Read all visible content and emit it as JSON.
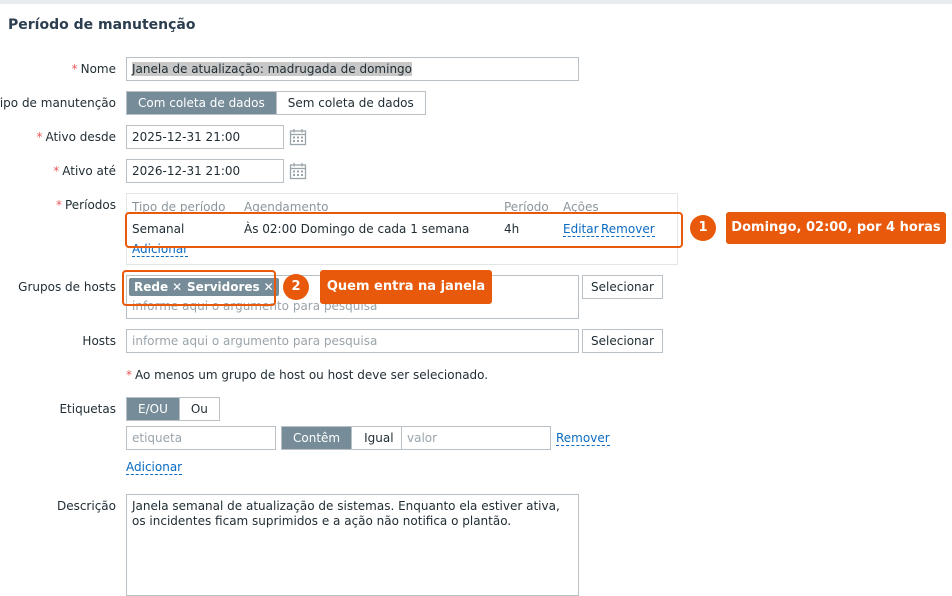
{
  "page": {
    "title": "Período de manutenção"
  },
  "form": {
    "name": {
      "label": "Nome",
      "value": "Janela de atualização: madrugada de domingo"
    },
    "maintenance_type": {
      "label": "Tipo de manutenção",
      "options": [
        "Com coleta de dados",
        "Sem coleta de dados"
      ],
      "selected": "Com coleta de dados"
    },
    "active_since": {
      "label": "Ativo desde",
      "value": "2025-12-31 21:00"
    },
    "active_till": {
      "label": "Ativo até",
      "value": "2026-12-31 21:00"
    },
    "periods": {
      "label": "Períodos",
      "headers": [
        "Tipo de período",
        "Agendamento",
        "Período",
        "Ações"
      ],
      "rows": [
        {
          "type": "Semanal",
          "schedule": "Às 02:00 Domingo de cada 1 semana",
          "period": "4h",
          "edit": "Editar",
          "remove": "Remover"
        }
      ],
      "add_label": "Adicionar"
    },
    "host_groups": {
      "label": "Grupos de hosts",
      "chips": [
        "Rede",
        "Servidores"
      ],
      "chip_remove_glyph": "✕",
      "placeholder": "informe aqui o argumento para pesquisa",
      "select_label": "Selecionar"
    },
    "hosts": {
      "label": "Hosts",
      "placeholder": "informe aqui o argumento para pesquisa",
      "select_label": "Selecionar"
    },
    "required_note": "Ao menos um grupo de host ou host deve ser selecionado.",
    "tags": {
      "label": "Etiquetas",
      "eval_options": [
        "E/OU",
        "Ou"
      ],
      "eval_selected": "E/OU",
      "tag_placeholder": "etiqueta",
      "operator_options": [
        "Contêm",
        "Igual"
      ],
      "operator_selected": "Contêm",
      "value_placeholder": "valor",
      "remove_label": "Remover",
      "add_label": "Adicionar"
    },
    "description": {
      "label": "Descrição",
      "value": "Janela semanal de atualização de sistemas. Enquanto ela estiver ativa, os incidentes ficam suprimidos e a ação não notifica o plantão."
    },
    "required_marker": "*"
  },
  "annotations": [
    {
      "number": "1",
      "text": "Domingo, 02:00, por 4 horas"
    },
    {
      "number": "2",
      "text": "Quem entra na janela"
    }
  ],
  "colors": {
    "accent_orange": "#e8590c",
    "active_segment": "#768d99",
    "link": "#0b6ac2",
    "required": "#e45959"
  }
}
